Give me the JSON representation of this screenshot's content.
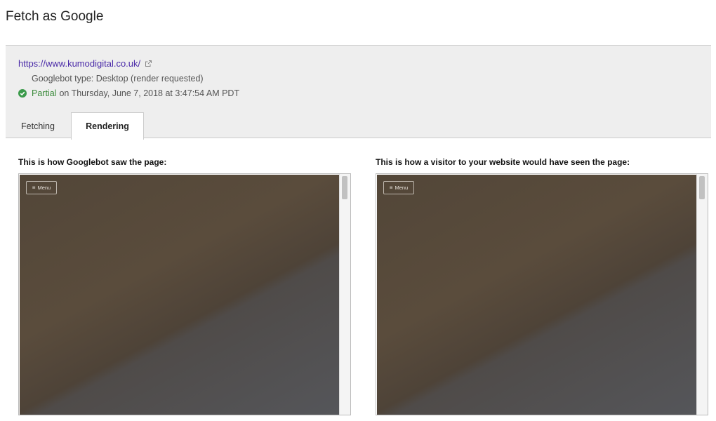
{
  "page": {
    "title": "Fetch as Google"
  },
  "fetch_info": {
    "url": "https://www.kumodigital.co.uk/",
    "bot_type": "Googlebot type: Desktop (render requested)",
    "status": "Partial",
    "status_detail": "on Thursday, June 7, 2018 at 3:47:54 AM PDT"
  },
  "tabs": [
    {
      "label": "Fetching",
      "active": false
    },
    {
      "label": "Rendering",
      "active": true
    }
  ],
  "renders": [
    {
      "caption": "This is how Googlebot saw the page:",
      "menu_label": "Menu"
    },
    {
      "caption": "This is how a visitor to your website would have seen the page:",
      "menu_label": "Menu"
    }
  ],
  "colors": {
    "link": "#4a2aa8",
    "status_ok": "#3a8a3a",
    "panel_bg": "#eeeeee"
  },
  "icons": {
    "external_link": "external-link-icon",
    "status": "check-circle-icon",
    "menu": "hamburger-icon"
  }
}
